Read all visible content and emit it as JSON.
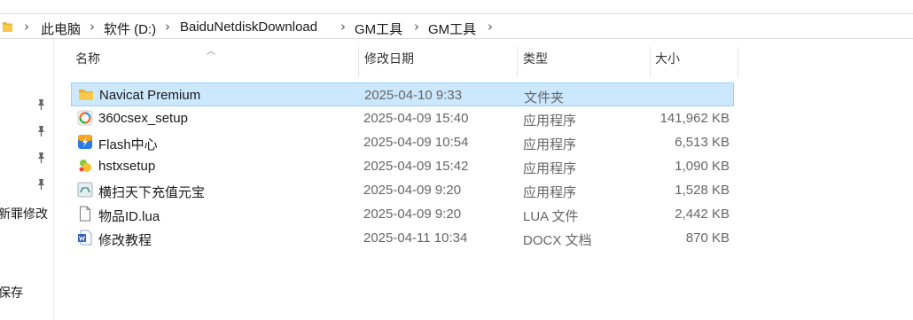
{
  "breadcrumb": [
    "此电脑",
    "软件 (D:)",
    "BaiduNetdiskDownload",
    "GM工具",
    "GM工具"
  ],
  "nav": {
    "labels": [
      "新罪修改",
      "保存"
    ]
  },
  "columns": {
    "name": "名称",
    "date": "修改日期",
    "type": "类型",
    "size": "大小"
  },
  "files": [
    {
      "name": "Navicat Premium",
      "date": "2025-04-10 9:33",
      "type": "文件夹",
      "size": "",
      "icon": "folder-icon",
      "selected": true
    },
    {
      "name": "360csex_setup",
      "date": "2025-04-09 15:40",
      "type": "应用程序",
      "size": "141,962 KB",
      "icon": "360-app-icon"
    },
    {
      "name": "Flash中心",
      "date": "2025-04-09 10:54",
      "type": "应用程序",
      "size": "6,513 KB",
      "icon": "flash-app-icon"
    },
    {
      "name": "hstxsetup",
      "date": "2025-04-09 15:42",
      "type": "应用程序",
      "size": "1,090 KB",
      "icon": "hstx-app-icon"
    },
    {
      "name": "横扫天下充值元宝",
      "date": "2025-04-09 9:20",
      "type": "应用程序",
      "size": "1,528 KB",
      "icon": "exe-app-icon"
    },
    {
      "name": "物品ID.lua",
      "date": "2025-04-09 9:20",
      "type": "LUA 文件",
      "size": "2,442 KB",
      "icon": "document-icon"
    },
    {
      "name": "修改教程",
      "date": "2025-04-11 10:34",
      "type": "DOCX 文档",
      "size": "870 KB",
      "icon": "word-doc-icon"
    }
  ],
  "colors": {
    "selection_bg": "#cce8ff",
    "selection_border": "#99d1ff",
    "folder": "#f8c94a"
  }
}
